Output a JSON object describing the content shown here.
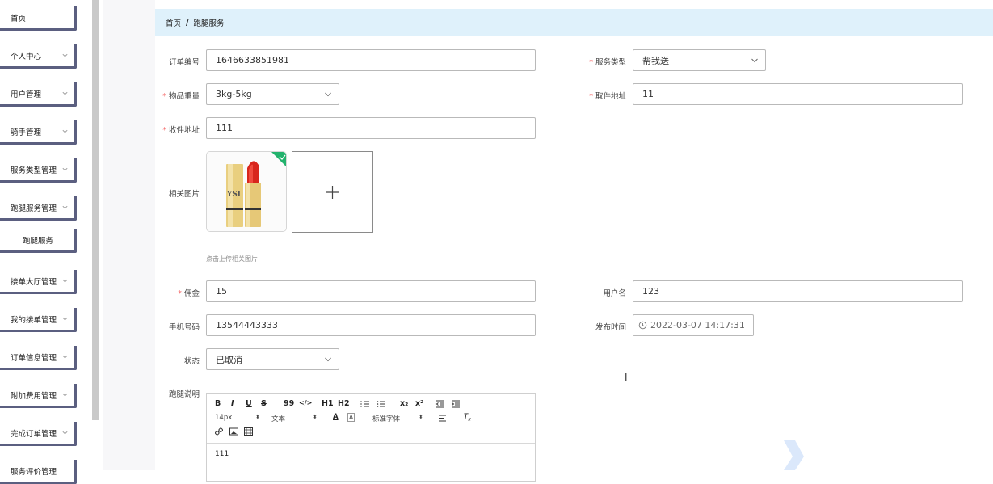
{
  "sidebar": {
    "items": [
      {
        "label": "首页"
      },
      {
        "label": "个人中心"
      },
      {
        "label": "用户管理"
      },
      {
        "label": "骑手管理"
      },
      {
        "label": "服务类型管理"
      },
      {
        "label": "跑腿服务管理"
      },
      {
        "label": "跑腿服务"
      },
      {
        "label": "接单大厅管理"
      },
      {
        "label": "我的接单管理"
      },
      {
        "label": "订单信息管理"
      },
      {
        "label": "附加费用管理"
      },
      {
        "label": "完成订单管理"
      },
      {
        "label": "服务评价管理"
      }
    ]
  },
  "breadcrumb": {
    "home": "首页",
    "separator": "/",
    "current": "跑腿服务"
  },
  "form": {
    "order_no": {
      "label": "订单编号",
      "value": "1646633851981"
    },
    "service_type": {
      "label": "服务类型",
      "value": "帮我送"
    },
    "weight": {
      "label": "物品重量",
      "value": "3kg-5kg"
    },
    "pickup_address": {
      "label": "取件地址",
      "value": "11"
    },
    "delivery_address": {
      "label": "收件地址",
      "value": "111"
    },
    "images": {
      "label": "相关图片",
      "hint": "点击上传相关图片",
      "add_icon": "+"
    },
    "commission": {
      "label": "佣金",
      "value": "15"
    },
    "username": {
      "label": "用户名",
      "value": "123"
    },
    "phone": {
      "label": "手机号码",
      "value": "13544443333"
    },
    "publish_time": {
      "label": "发布时间",
      "value": "2022-03-07 14:17:31"
    },
    "status": {
      "label": "状态",
      "value": "已取消"
    },
    "description": {
      "label": "跑腿说明",
      "content": "111"
    }
  },
  "editor_toolbar": {
    "row1": [
      "B",
      "I",
      "U",
      "S",
      "99",
      "</>",
      "H1",
      "H2",
      "OL",
      "UL",
      "x₂",
      "x²",
      "outdent",
      "indent"
    ],
    "font_size": "14px",
    "text_style": "文本",
    "font_family": "标准字体"
  },
  "colors": {
    "accent_green": "#23b26d",
    "breadcrumb_bg": "#dff1fb",
    "required": "#f56c6c",
    "sidebar_border": "#5b5f80"
  }
}
